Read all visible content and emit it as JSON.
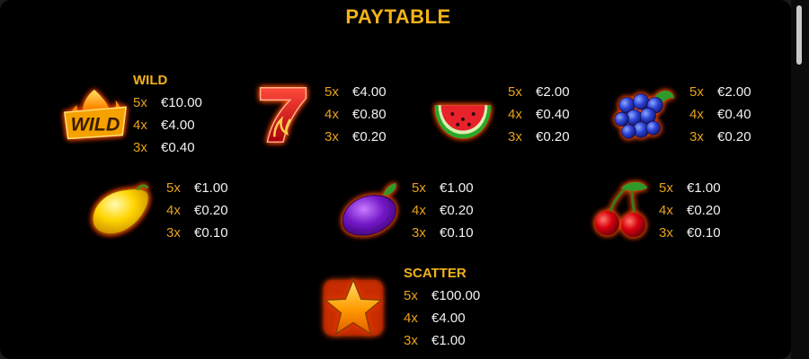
{
  "title": "PAYTABLE",
  "colors": {
    "accent": "#f2b21a",
    "multiplier": "#e8a21b",
    "value": "#f3f3f3",
    "background": "#000000"
  },
  "symbols": [
    {
      "icon": "wild-flame-icon",
      "label": "WILD",
      "pays": [
        {
          "mult": "5x",
          "value": "€10.00"
        },
        {
          "mult": "4x",
          "value": "€4.00"
        },
        {
          "mult": "3x",
          "value": "€0.40"
        }
      ]
    },
    {
      "icon": "seven-icon",
      "pays": [
        {
          "mult": "5x",
          "value": "€4.00"
        },
        {
          "mult": "4x",
          "value": "€0.80"
        },
        {
          "mult": "3x",
          "value": "€0.20"
        }
      ]
    },
    {
      "icon": "watermelon-icon",
      "pays": [
        {
          "mult": "5x",
          "value": "€2.00"
        },
        {
          "mult": "4x",
          "value": "€0.40"
        },
        {
          "mult": "3x",
          "value": "€0.20"
        }
      ]
    },
    {
      "icon": "grapes-icon",
      "pays": [
        {
          "mult": "5x",
          "value": "€2.00"
        },
        {
          "mult": "4x",
          "value": "€0.40"
        },
        {
          "mult": "3x",
          "value": "€0.20"
        }
      ]
    },
    {
      "icon": "lemon-icon",
      "pays": [
        {
          "mult": "5x",
          "value": "€1.00"
        },
        {
          "mult": "4x",
          "value": "€0.20"
        },
        {
          "mult": "3x",
          "value": "€0.10"
        }
      ]
    },
    {
      "icon": "plum-icon",
      "pays": [
        {
          "mult": "5x",
          "value": "€1.00"
        },
        {
          "mult": "4x",
          "value": "€0.20"
        },
        {
          "mult": "3x",
          "value": "€0.10"
        }
      ]
    },
    {
      "icon": "cherries-icon",
      "pays": [
        {
          "mult": "5x",
          "value": "€1.00"
        },
        {
          "mult": "4x",
          "value": "€0.20"
        },
        {
          "mult": "3x",
          "value": "€0.10"
        }
      ]
    },
    {
      "icon": "star-scatter-icon",
      "label": "SCATTER",
      "pays": [
        {
          "mult": "5x",
          "value": "€100.00"
        },
        {
          "mult": "4x",
          "value": "€4.00"
        },
        {
          "mult": "3x",
          "value": "€1.00"
        }
      ]
    }
  ],
  "wild_icon_text": "WILD"
}
